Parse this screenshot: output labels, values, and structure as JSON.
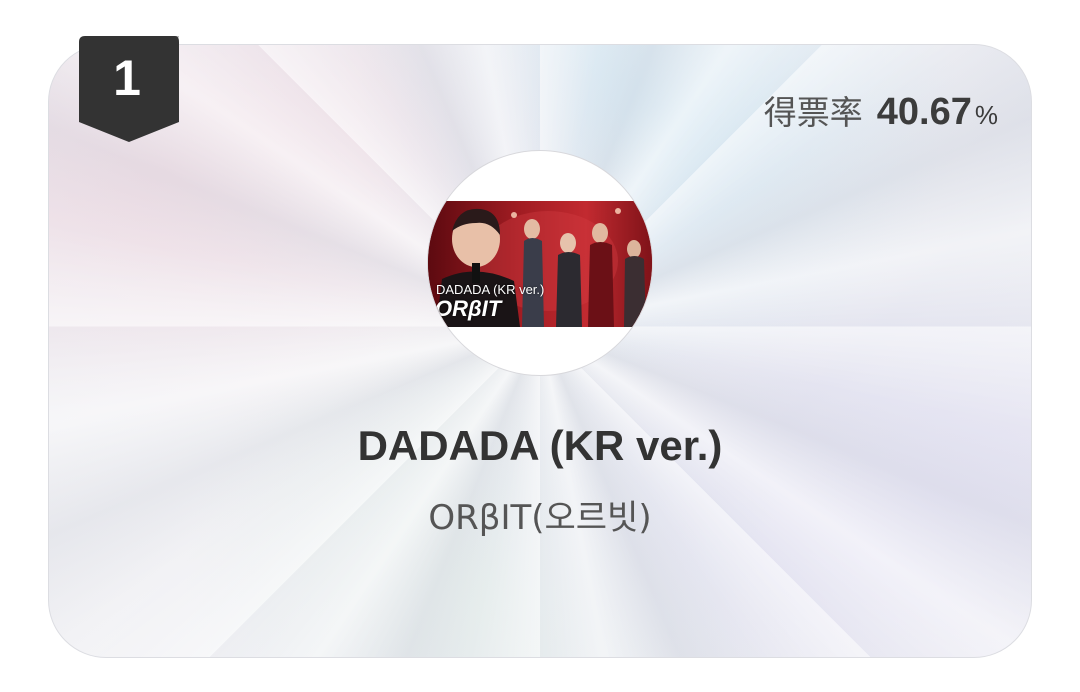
{
  "rank": {
    "number": "1",
    "badge_color": "#333333"
  },
  "vote": {
    "label": "得票率",
    "value": "40.67",
    "unit": "%"
  },
  "thumbnail": {
    "caption": "DADADA (KR ver.)",
    "logo": "ORβIT",
    "accent": "#9b1a20"
  },
  "song": {
    "title": "DADADA (KR ver.)",
    "artist": "ORβIT(오르빗)"
  }
}
